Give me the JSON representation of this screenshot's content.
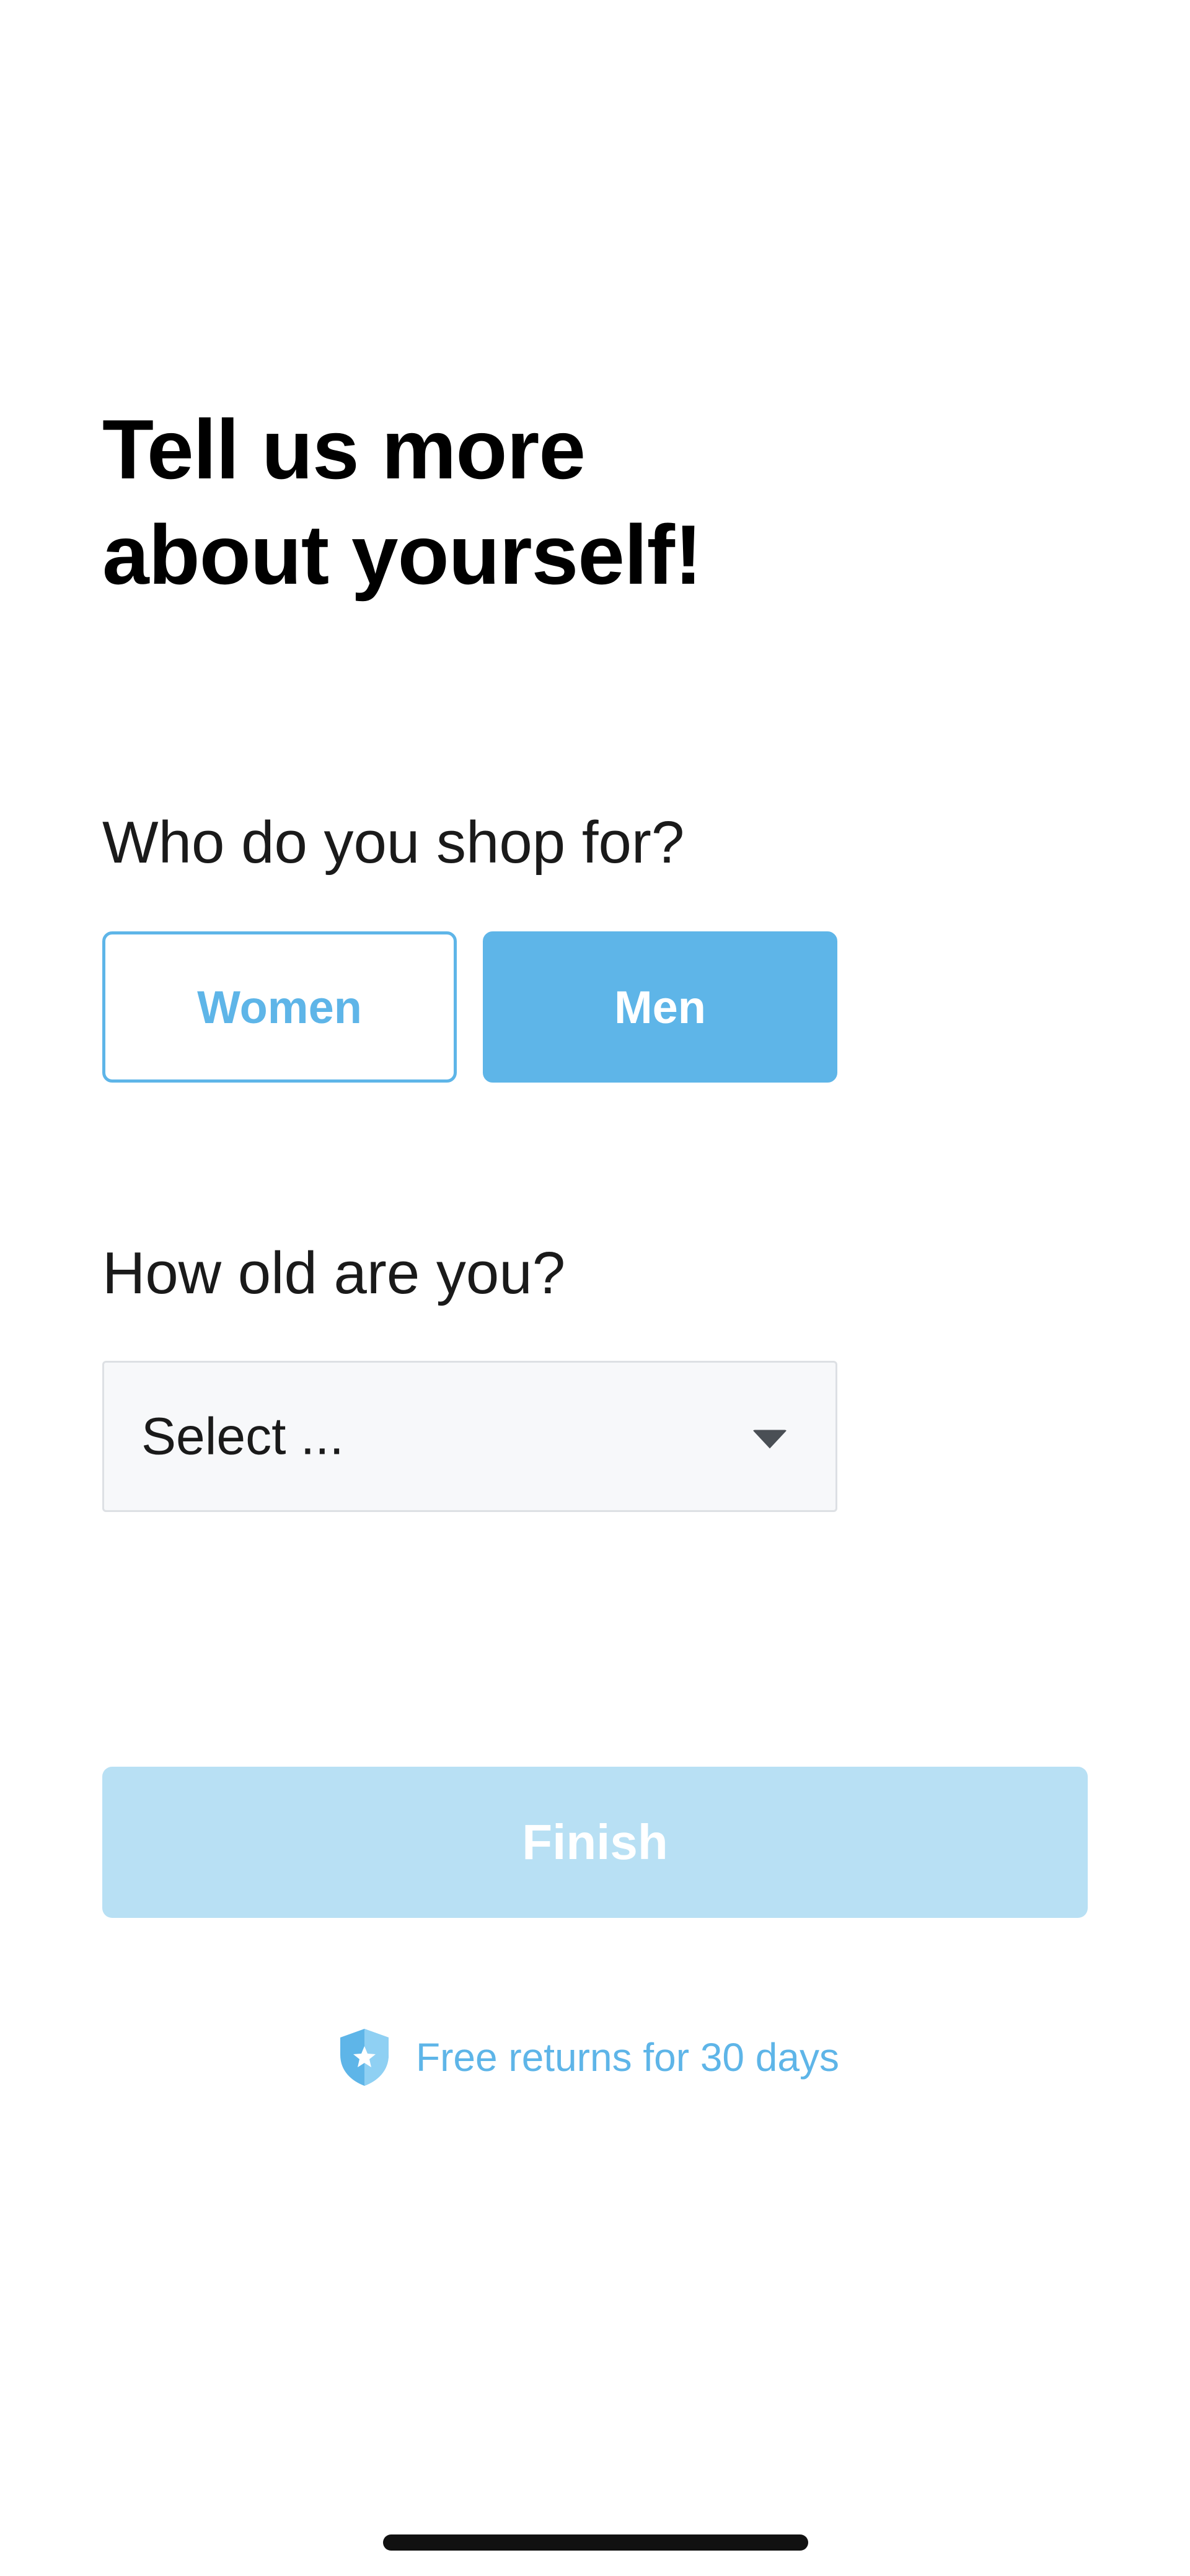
{
  "heading": {
    "line1": "Tell us more",
    "line2": "about yourself!"
  },
  "shop_for": {
    "question": "Who do you shop for?",
    "options": [
      "Women",
      "Men"
    ],
    "selected": "Men"
  },
  "age": {
    "question": "How old are you?",
    "select_value": "Select ..."
  },
  "finish": {
    "label": "Finish",
    "enabled": false
  },
  "returns": {
    "text": "Free returns for 30 days",
    "icon": "shield-star-icon"
  },
  "colors": {
    "accent": "#5eb5e8",
    "accent_disabled": "#b8e0f4",
    "select_background": "#f7f8fa"
  }
}
